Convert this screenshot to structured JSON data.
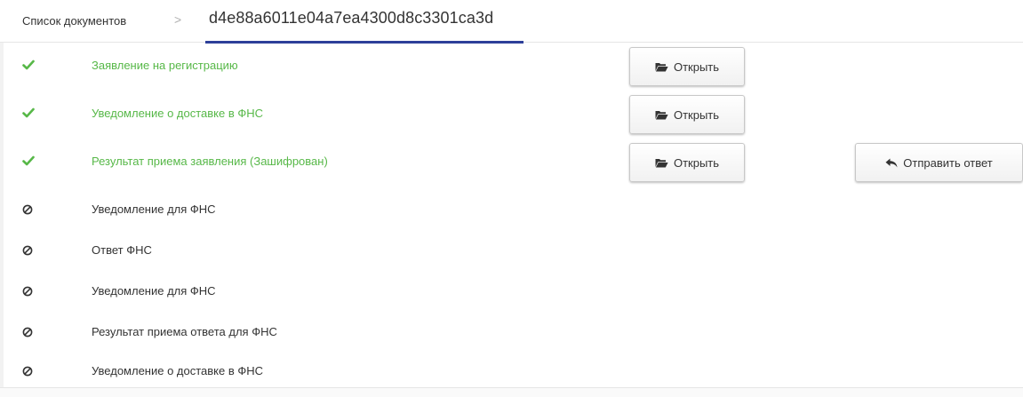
{
  "breadcrumb": {
    "root_label": "Список документов",
    "separator": ">",
    "current_label": "d4e88a6011e04a7ea4300d8c3301ca3d"
  },
  "documents": [
    {
      "title": "Заявление на регистрацию",
      "status": "ok",
      "status_icon": "check-icon",
      "open_label": "Открыть"
    },
    {
      "title": "Уведомление о доставке в ФНС",
      "status": "ok",
      "status_icon": "check-icon",
      "open_label": "Открыть"
    },
    {
      "title": "Результат приема заявления (Зашифрован)",
      "status": "ok",
      "status_icon": "check-icon",
      "open_label": "Открыть",
      "reply_label": "Отправить ответ"
    },
    {
      "title": "Уведомление для ФНС",
      "status": "pending",
      "status_icon": "ban-icon"
    },
    {
      "title": "Ответ ФНС",
      "status": "pending",
      "status_icon": "ban-icon"
    },
    {
      "title": "Уведомление для ФНС",
      "status": "pending",
      "status_icon": "ban-icon"
    },
    {
      "title": "Результат приема ответа для ФНС",
      "status": "pending",
      "status_icon": "ban-icon"
    },
    {
      "title": "Уведомление о доставке в ФНС",
      "status": "pending",
      "status_icon": "ban-icon"
    }
  ],
  "icons": {
    "open": "folder-open-icon",
    "reply": "reply-icon"
  },
  "colors": {
    "success_text": "#57b848",
    "accent_underline": "#2d3f99",
    "default_text": "#333333"
  }
}
